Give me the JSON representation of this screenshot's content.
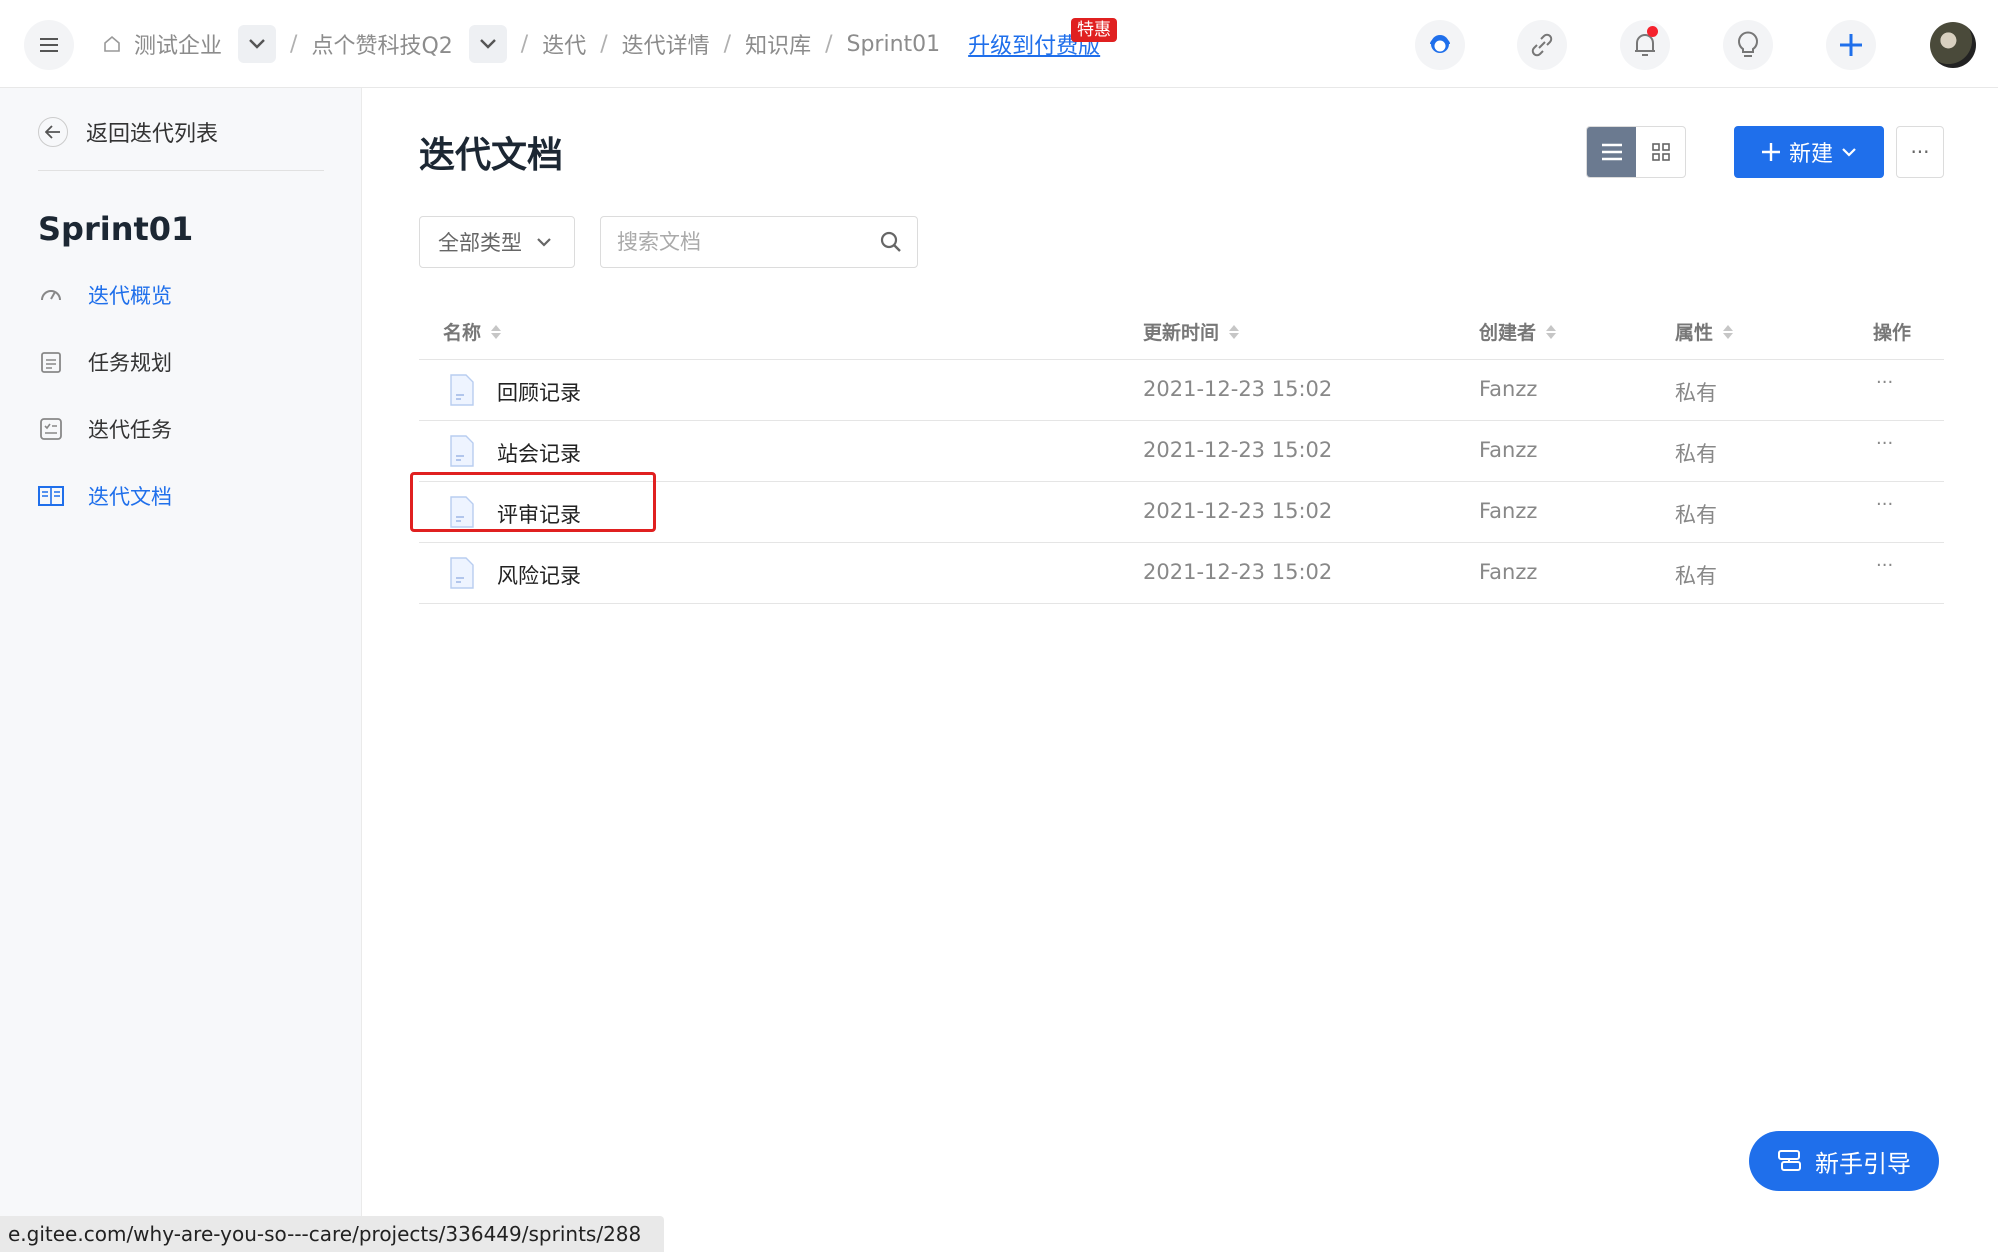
{
  "breadcrumb": {
    "items": [
      "测试企业",
      "点个赞科技Q2",
      "迭代",
      "迭代详情",
      "知识库",
      "Sprint01"
    ],
    "separator": "/",
    "upgrade_link": "升级到付费版",
    "promo_badge": "特惠"
  },
  "colors": {
    "accent": "#1f6feb",
    "highlight": "#e02020",
    "notification_dot": "#f5222d"
  },
  "sidebar": {
    "back_label": "返回迭代列表",
    "sprint_title": "Sprint01",
    "items": [
      {
        "label": "迭代概览",
        "icon": "dashboard-icon",
        "active": true
      },
      {
        "label": "任务规划",
        "icon": "calendar-icon",
        "active": false
      },
      {
        "label": "迭代任务",
        "icon": "checklist-icon",
        "active": false
      },
      {
        "label": "迭代文档",
        "icon": "book-icon",
        "active": true
      }
    ]
  },
  "main": {
    "title": "迭代文档",
    "new_button": "新建",
    "more_label": "···",
    "type_filter": "全部类型",
    "search_placeholder": "搜索文档",
    "columns": [
      "名称",
      "更新时间",
      "创建者",
      "属性",
      "操作"
    ],
    "rows": [
      {
        "name": "回顾记录",
        "updated": "2021-12-23 15:02",
        "creator": "Fanzz",
        "attr": "私有",
        "ops": "···"
      },
      {
        "name": "站会记录",
        "updated": "2021-12-23 15:02",
        "creator": "Fanzz",
        "attr": "私有",
        "ops": "···"
      },
      {
        "name": "评审记录",
        "updated": "2021-12-23 15:02",
        "creator": "Fanzz",
        "attr": "私有",
        "ops": "···"
      },
      {
        "name": "风险记录",
        "updated": "2021-12-23 15:02",
        "creator": "Fanzz",
        "attr": "私有",
        "ops": "···"
      }
    ]
  },
  "guide_button": "新手引导",
  "status_url": "e.gitee.com/why-are-you-so---care/projects/336449/sprints/288"
}
